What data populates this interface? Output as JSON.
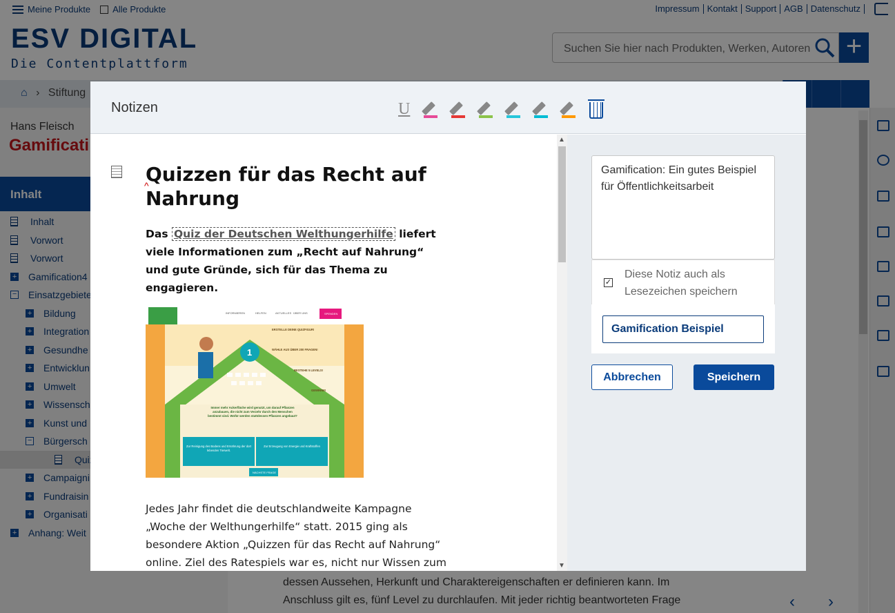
{
  "topbar": {
    "my_products": "Meine Produkte",
    "all_products": "Alle Produkte",
    "links": [
      "Impressum",
      "Kontakt",
      "Support",
      "AGB",
      "Datenschutz"
    ]
  },
  "logo": {
    "brand": "ESV DIGITAL",
    "tagline": "Die Contentplattform"
  },
  "search": {
    "placeholder": "Suchen Sie hier nach Produkten, Werken, Autoren"
  },
  "breadcrumb": {
    "item": "Stiftung"
  },
  "book": {
    "author": "Hans Fleisch",
    "title": "Gamificati"
  },
  "sidebar": {
    "heading": "Inhalt",
    "items": [
      {
        "label": "Inhalt",
        "type": "doc",
        "indent": 0
      },
      {
        "label": "Vorwort",
        "type": "doc",
        "indent": 0
      },
      {
        "label": "Vorwort",
        "type": "doc",
        "indent": 0
      },
      {
        "label": "Gamification4",
        "type": "plus",
        "indent": 0
      },
      {
        "label": "Einsatzgebiete",
        "type": "minus",
        "indent": 0
      },
      {
        "label": "Bildung",
        "type": "plus",
        "indent": 1
      },
      {
        "label": "Integration",
        "type": "plus",
        "indent": 1
      },
      {
        "label": "Gesundhe",
        "type": "plus",
        "indent": 1
      },
      {
        "label": "Entwicklun",
        "type": "plus",
        "indent": 1
      },
      {
        "label": "Umwelt",
        "type": "plus",
        "indent": 1
      },
      {
        "label": "Wissensch",
        "type": "plus",
        "indent": 1
      },
      {
        "label": "Kunst und",
        "type": "plus",
        "indent": 1
      },
      {
        "label": "Bürgersch",
        "type": "minus",
        "indent": 1
      },
      {
        "label": "Quizzen",
        "type": "doc",
        "indent": 2,
        "selected": true
      },
      {
        "label": "Campaigni",
        "type": "plus",
        "indent": 1
      },
      {
        "label": "Fundraisin",
        "type": "plus",
        "indent": 1
      },
      {
        "label": "Organisati",
        "type": "plus",
        "indent": 1
      },
      {
        "label": "Anhang: Weit",
        "type": "plus",
        "indent": 0
      }
    ]
  },
  "background_text": "dessen Aussehen, Herkunft und Charaktereigenschaften er definieren kann. Im Anschluss gilt es, fünf Level zu durchlaufen. Mit jeder richtig beantworteten Frage",
  "modal": {
    "title": "Notizen",
    "highlight_colors": [
      "#e64a97",
      "#e53935",
      "#8bc34a",
      "#26c6da",
      "#00bcd4",
      "#ff9800"
    ],
    "article": {
      "heading": "Quizzen für das Recht auf Nahrung",
      "lead_before": "Das ",
      "lead_link": "Quiz der Deutschen Welthungerhilfe",
      "lead_after": " liefert viele Informationen zum „Recht auf Nahrung“ und gute Gründe, sich für das Thema zu engagieren.",
      "image": {
        "nav": [
          "INFORMIEREN",
          "HELFEN",
          "AKTUELLES",
          "ÜBER UNS",
          "SPENDEN"
        ],
        "steps": [
          "ERSTELLE DEINE QUIZFIGUR!",
          "WÄHLE AUS ÜBER 200 FRAGEN!",
          "BESTEHE 5 LEVELS!",
          "GEWINNE!"
        ],
        "level": "1",
        "question": "Immer mehr Ackerfläche wird genutzt, um darauf Pflanzen anzubauen, die nicht zum Verzehr durch den Menschen bestimmt sind. Wofür werden stattdessen Pflanzen angebaut?",
        "answers": [
          "Zur Reinigung des Bodens und Ernährung der dort lebenden Tierwelt.",
          "Zur Erzeugung von Energie und Kraftstoffen"
        ],
        "next": "NÄCHSTE FRAGE"
      },
      "body": "Jedes Jahr findet die deutschlandweite Kampagne „Woche der Welthungerhilfe“ statt. 2015 ging als besondere Aktion „Quizzen für das Recht auf Nahrung“ online. Ziel des Ratespiels war es, nicht nur Wissen zum Thema zu"
    },
    "note": {
      "text": "Gamification: Ein gutes Beispiel für Öffentlichkeitsarbeit",
      "bookmark_label": "Diese Notiz auch als Lesezeichen speichern",
      "bookmark_checked": true,
      "bookmark_title": "Gamification Beispiel",
      "cancel": "Abbrechen",
      "save": "Speichern"
    }
  },
  "pager": {
    "prev": "‹",
    "next": "›"
  }
}
